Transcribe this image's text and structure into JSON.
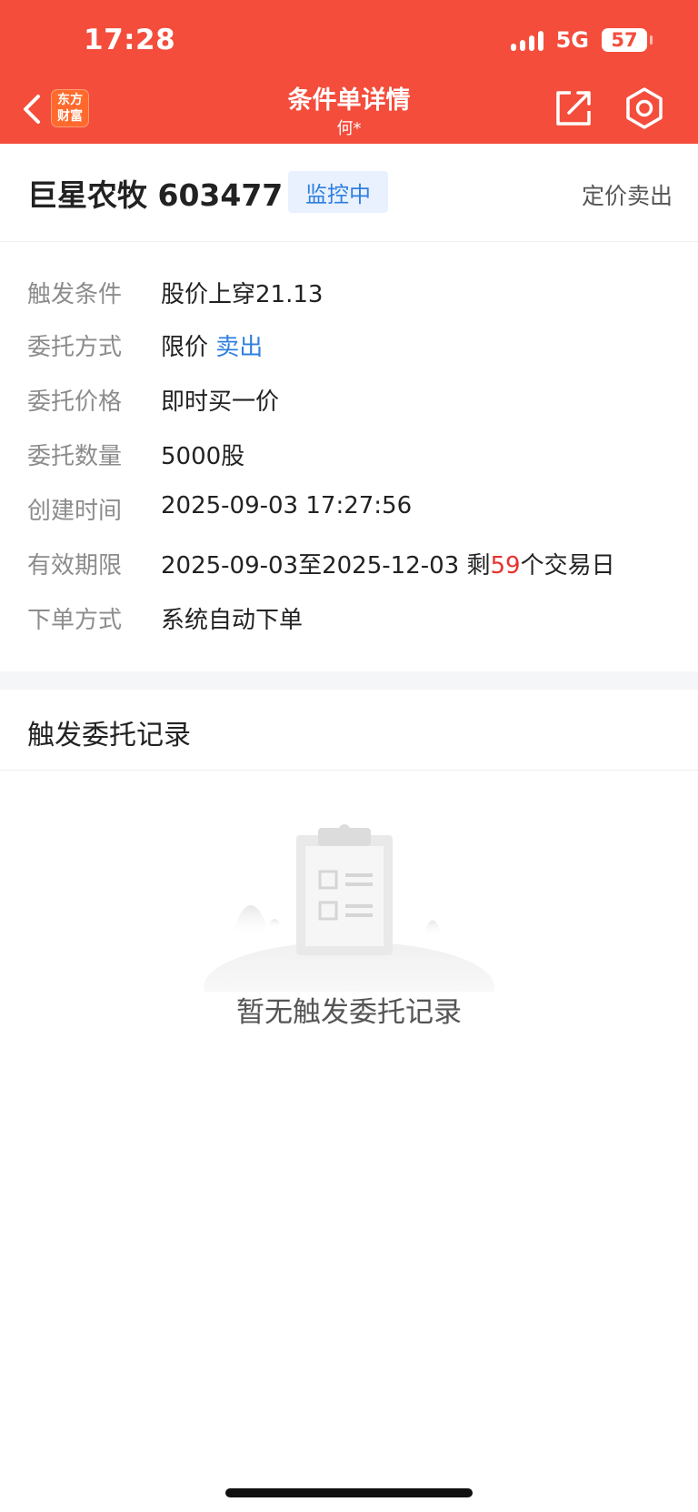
{
  "status_bar": {
    "time": "17:28",
    "network": "5G",
    "battery": "57"
  },
  "nav": {
    "logo_line1": "东方",
    "logo_line2": "财富",
    "title": "条件单详情",
    "subtitle": "何*"
  },
  "stock": {
    "name_code": "巨星农牧 603477",
    "status": "监控中",
    "order_type": "定价卖出"
  },
  "details": [
    {
      "label": "触发条件",
      "value": "股价上穿21.13"
    },
    {
      "label": "委托方式",
      "value": "限价",
      "value_highlight": "卖出"
    },
    {
      "label": "委托价格",
      "value": "即时买一价"
    },
    {
      "label": "委托数量",
      "value": "5000股"
    },
    {
      "label": "创建时间",
      "value": "2025-09-03 17:27:56"
    },
    {
      "label": "有效期限",
      "value": "2025-09-03至2025-12-03 剩",
      "days": "59",
      "suffix": "个交易日"
    },
    {
      "label": "下单方式",
      "value": "系统自动下单"
    }
  ],
  "records": {
    "title": "触发委托记录",
    "empty_text": "暂无触发委托记录"
  },
  "colors": {
    "header_bg": "#f44d3c",
    "accent_blue": "#2f7fe0",
    "highlight_red": "#e8322d"
  },
  "icons": [
    "back-arrow-icon",
    "share-icon",
    "gear-icon",
    "clipboard-icon"
  ]
}
